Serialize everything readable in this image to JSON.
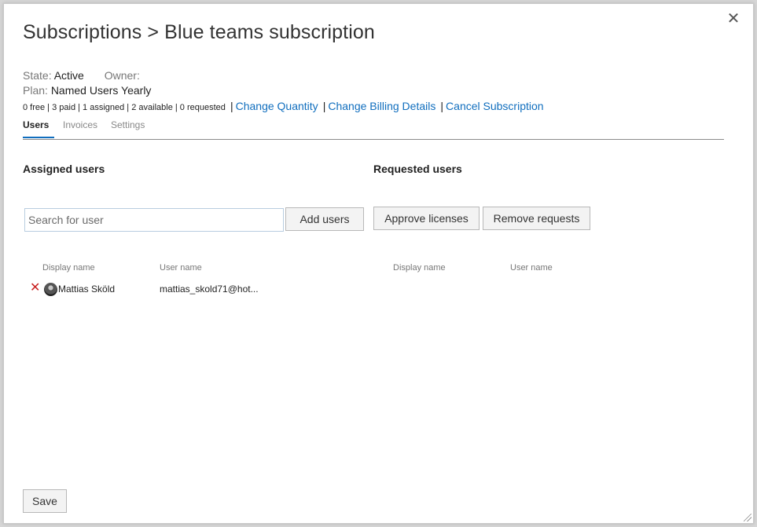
{
  "dialog": {
    "title": "Subscriptions > Blue teams subscription",
    "close_glyph": "✕"
  },
  "meta": {
    "state_label": "State:",
    "state_value": "Active",
    "owner_label": "Owner:",
    "owner_value": "",
    "plan_label": "Plan:",
    "plan_value": "Named Users Yearly",
    "counts": "0 free | 3 paid | 1 assigned | 2 available | 0 requested",
    "links": {
      "change_quantity": "Change Quantity",
      "change_billing": "Change Billing Details",
      "cancel_subscription": "Cancel Subscription"
    },
    "separator": "|"
  },
  "tabs": [
    {
      "label": "Users",
      "active": true
    },
    {
      "label": "Invoices",
      "active": false
    },
    {
      "label": "Settings",
      "active": false
    }
  ],
  "assigned": {
    "title": "Assigned users",
    "search_placeholder": "Search for user",
    "add_users_label": "Add users",
    "columns": [
      "Display name",
      "User name"
    ],
    "rows": [
      {
        "display_name": "Mattias Sköld",
        "user_name": "mattias_skold71@hot..."
      }
    ]
  },
  "requested": {
    "title": "Requested users",
    "approve_label": "Approve licenses",
    "remove_label": "Remove requests",
    "columns": [
      "Display name",
      "User name"
    ]
  },
  "footer": {
    "save_label": "Save"
  },
  "icons": {
    "remove": "remove-icon",
    "close": "close-icon",
    "avatar": "user-avatar"
  },
  "colors": {
    "link": "#106ebe",
    "remove": "#c82020",
    "tab_accent": "#106ebe"
  }
}
